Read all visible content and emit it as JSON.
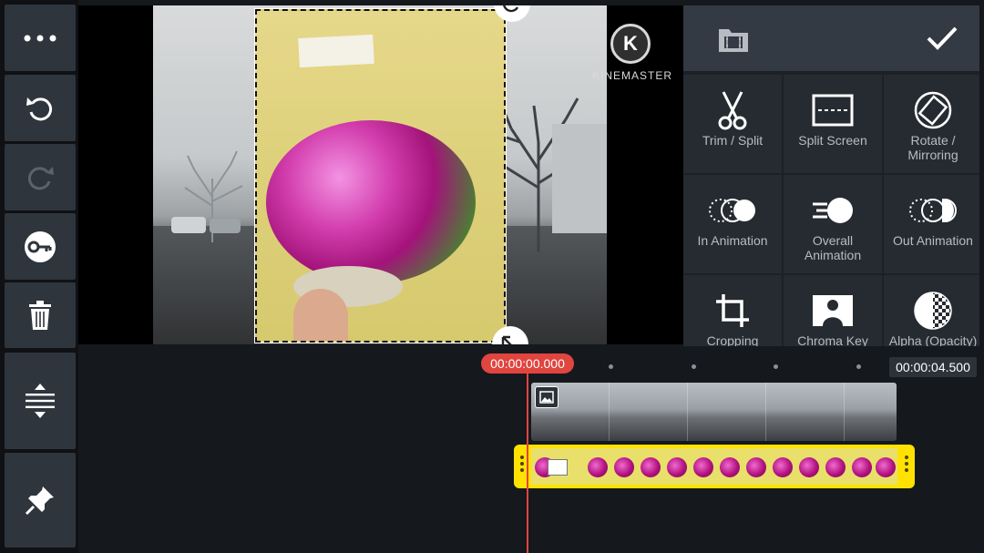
{
  "app": {
    "name": "KineMaster"
  },
  "watermark": {
    "letter": "K",
    "text": "KINEMASTER"
  },
  "left_toolbar": {
    "items": [
      {
        "name": "more",
        "icon": "ellipsis-icon"
      },
      {
        "name": "undo",
        "icon": "undo-icon"
      },
      {
        "name": "redo",
        "icon": "redo-icon"
      },
      {
        "name": "keyframe",
        "icon": "key-icon"
      },
      {
        "name": "delete",
        "icon": "trash-icon"
      },
      {
        "name": "timeline-expand",
        "icon": "expand-vertical-icon"
      },
      {
        "name": "pin",
        "icon": "pin-icon"
      }
    ]
  },
  "panel": {
    "header_icon": "film-folder-icon",
    "confirm_icon": "checkmark-icon",
    "tools": [
      {
        "label": "Trim / Split",
        "icon": "scissors-icon"
      },
      {
        "label": "Split Screen",
        "icon": "split-screen-icon"
      },
      {
        "label": "Rotate / Mirroring",
        "icon": "rotate-icon"
      },
      {
        "label": "In Animation",
        "icon": "in-animation-icon"
      },
      {
        "label": "Overall Animation",
        "icon": "overall-animation-icon"
      },
      {
        "label": "Out Animation",
        "icon": "out-animation-icon"
      },
      {
        "label": "Cropping",
        "icon": "crop-icon"
      },
      {
        "label": "Chroma Key",
        "icon": "chroma-key-icon"
      },
      {
        "label": "Alpha (Opacity)",
        "icon": "alpha-icon"
      }
    ]
  },
  "timeline": {
    "current_time": "00:00:00.000",
    "end_time": "00:00:04.500"
  },
  "colors": {
    "accent_red": "#e0453f",
    "layer_yellow": "#ffe200",
    "panel_bg": "#1d2126",
    "toolbar_button": "#2f353d"
  }
}
